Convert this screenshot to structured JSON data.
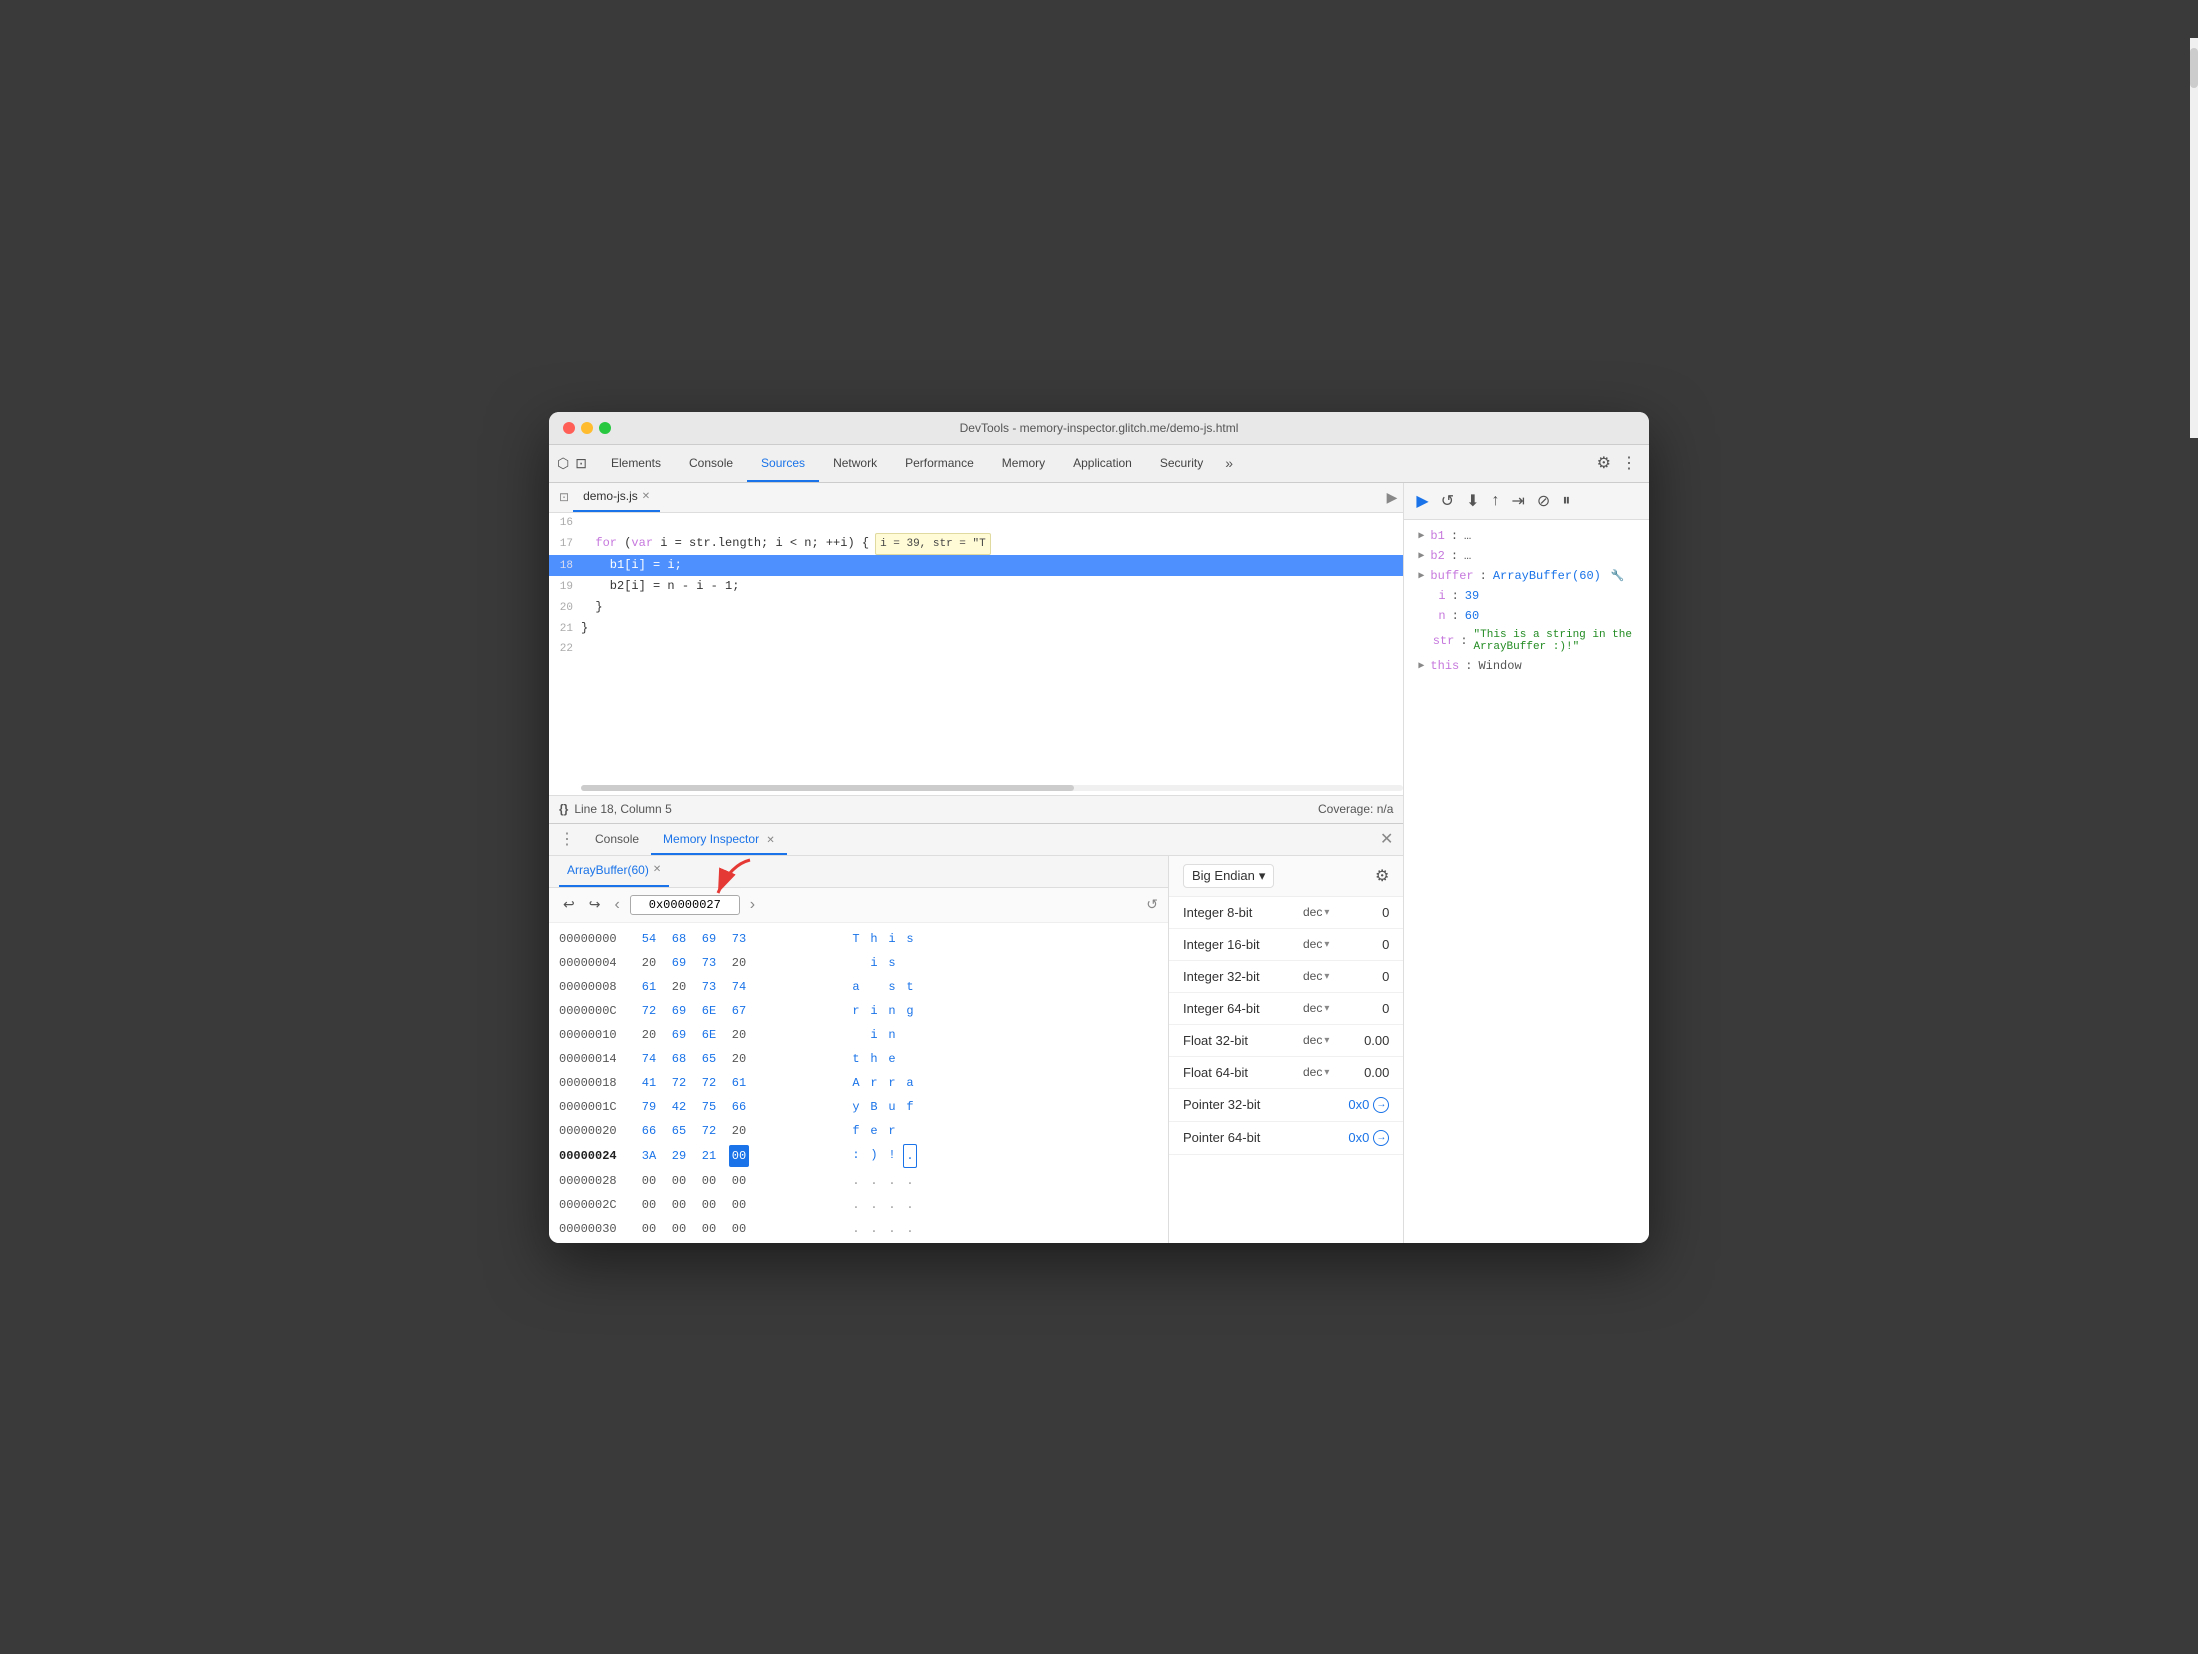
{
  "window": {
    "title": "DevTools - memory-inspector.glitch.me/demo-js.html",
    "traffic_lights": [
      "red",
      "yellow",
      "green"
    ]
  },
  "devtools_tabs": {
    "items": [
      {
        "label": "Elements",
        "active": false
      },
      {
        "label": "Console",
        "active": false
      },
      {
        "label": "Sources",
        "active": true
      },
      {
        "label": "Network",
        "active": false
      },
      {
        "label": "Performance",
        "active": false
      },
      {
        "label": "Memory",
        "active": false
      },
      {
        "label": "Application",
        "active": false
      },
      {
        "label": "Security",
        "active": false
      }
    ],
    "more_label": "»"
  },
  "editor": {
    "file_tab": "demo-js.js",
    "lines": [
      {
        "num": "16",
        "content": ""
      },
      {
        "num": "17",
        "content": "  for (var i = str.length; i < n; ++i) {",
        "tooltip": "i = 39, str = \"T",
        "highlighted": false
      },
      {
        "num": "18",
        "content": "    b1[i] = i;",
        "highlighted": true
      },
      {
        "num": "19",
        "content": "    b2[i] = n - i - 1;",
        "highlighted": false
      },
      {
        "num": "20",
        "content": "  }",
        "highlighted": false
      },
      {
        "num": "21",
        "content": "}",
        "highlighted": false
      },
      {
        "num": "22",
        "content": "",
        "highlighted": false
      }
    ],
    "status": {
      "line_col": "Line 18, Column 5",
      "coverage": "Coverage: n/a"
    }
  },
  "bottom_panel": {
    "tabs": [
      {
        "label": "Console",
        "active": false
      },
      {
        "label": "Memory Inspector",
        "active": true,
        "closeable": true
      }
    ]
  },
  "memory_inspector": {
    "buffer_tab": "ArrayBuffer(60)",
    "controls": {
      "address": "0x00000027",
      "nav_prev": "‹",
      "nav_next": "›"
    },
    "rows": [
      {
        "addr": "00000000",
        "bytes": [
          "54",
          "68",
          "69",
          "73"
        ],
        "chars": [
          "T",
          "h",
          "i",
          "s"
        ]
      },
      {
        "addr": "00000004",
        "bytes": [
          "20",
          "69",
          "73",
          "20"
        ],
        "chars": [
          " ",
          "i",
          "s",
          " "
        ]
      },
      {
        "addr": "00000008",
        "bytes": [
          "61",
          "20",
          "73",
          "74"
        ],
        "chars": [
          "a",
          " ",
          "s",
          "t"
        ]
      },
      {
        "addr": "0000000C",
        "bytes": [
          "72",
          "69",
          "6E",
          "67"
        ],
        "chars": [
          "r",
          "i",
          "n",
          "g"
        ]
      },
      {
        "addr": "00000010",
        "bytes": [
          "20",
          "69",
          "6E",
          "20"
        ],
        "chars": [
          " ",
          "i",
          "n",
          " "
        ]
      },
      {
        "addr": "00000014",
        "bytes": [
          "74",
          "68",
          "65",
          "20"
        ],
        "chars": [
          "t",
          "h",
          "e",
          " "
        ]
      },
      {
        "addr": "00000018",
        "bytes": [
          "41",
          "72",
          "72",
          "61"
        ],
        "chars": [
          "A",
          "r",
          "r",
          "a"
        ]
      },
      {
        "addr": "0000001C",
        "bytes": [
          "79",
          "42",
          "75",
          "66"
        ],
        "chars": [
          "y",
          "B",
          "u",
          "f"
        ]
      },
      {
        "addr": "00000020",
        "bytes": [
          "66",
          "65",
          "72",
          "20"
        ],
        "chars": [
          "f",
          "e",
          "r",
          " "
        ]
      },
      {
        "addr": "00000024",
        "bytes": [
          "3A",
          "29",
          "21",
          "00"
        ],
        "chars": [
          ":",
          ")",
          "!",
          "."
        ],
        "selected_byte": 3,
        "is_selected_row": true
      },
      {
        "addr": "00000028",
        "bytes": [
          "00",
          "00",
          "00",
          "00"
        ],
        "chars": [
          ".",
          ".",
          ".",
          "."
        ]
      },
      {
        "addr": "0000002C",
        "bytes": [
          "00",
          "00",
          "00",
          "00"
        ],
        "chars": [
          ".",
          ".",
          ".",
          "."
        ]
      },
      {
        "addr": "00000030",
        "bytes": [
          "00",
          "00",
          "00",
          "00"
        ],
        "chars": [
          ".",
          ".",
          ".",
          "."
        ]
      }
    ]
  },
  "value_panel": {
    "endian": {
      "label": "Big Endian",
      "arrow": "▾"
    },
    "rows": [
      {
        "label": "Integer 8-bit",
        "format": "dec",
        "value": "0"
      },
      {
        "label": "Integer 16-bit",
        "format": "dec",
        "value": "0"
      },
      {
        "label": "Integer 32-bit",
        "format": "dec",
        "value": "0"
      },
      {
        "label": "Integer 64-bit",
        "format": "dec",
        "value": "0"
      },
      {
        "label": "Float 32-bit",
        "format": "dec",
        "value": "0.00"
      },
      {
        "label": "Float 64-bit",
        "format": "dec",
        "value": "0.00"
      },
      {
        "label": "Pointer 32-bit",
        "format": null,
        "value": "0x0",
        "is_link": true
      },
      {
        "label": "Pointer 64-bit",
        "format": null,
        "value": "0x0",
        "is_link": true
      }
    ]
  },
  "debugger": {
    "scope": [
      {
        "key": "b1",
        "val": "…",
        "expandable": true
      },
      {
        "key": "b2",
        "val": "…",
        "expandable": true
      },
      {
        "key": "buffer",
        "val": "ArrayBuffer(60) 🔧",
        "expandable": true
      },
      {
        "key": "i",
        "val": "39",
        "expandable": false
      },
      {
        "key": "n",
        "val": "60",
        "expandable": false
      },
      {
        "key": "str",
        "val": "\"This is a string in the ArrayBuffer :)!\"",
        "expandable": false
      },
      {
        "key": "this",
        "val": "Window",
        "expandable": true
      }
    ]
  }
}
